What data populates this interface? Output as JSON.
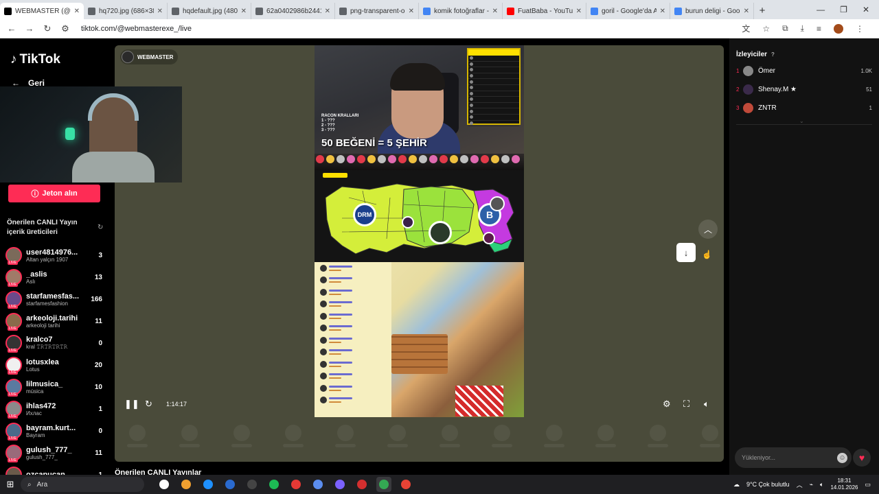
{
  "browser": {
    "tabs": [
      {
        "title": "WEBMASTER (@w",
        "color": "#000000",
        "active": true
      },
      {
        "title": "hq720.jpg (686×386)",
        "color": "#5f6368"
      },
      {
        "title": "hqdefault.jpg (480×3",
        "color": "#5f6368"
      },
      {
        "title": "62a0402986b24419a",
        "color": "#5f6368"
      },
      {
        "title": "png-transparent-ogg",
        "color": "#5f6368"
      },
      {
        "title": "komik fotoğraflar - G",
        "color": "#4285f4"
      },
      {
        "title": "FuatBaba - YouTube",
        "color": "#ff0000"
      },
      {
        "title": "goril - Google'da Ara",
        "color": "#4285f4"
      },
      {
        "title": "burun deligi - Googl",
        "color": "#4285f4"
      }
    ],
    "url": "tiktok.com/@webmasterexe_/live"
  },
  "sidebar": {
    "logo": "TikTok",
    "back_label": "Geri",
    "jeton_label": "Jeton alın",
    "suggested_title": "Önerilen CANLI Yayın içerik üreticileri",
    "creators": [
      {
        "name": "user4814976...",
        "sub": "Altan yalçın 1907",
        "count": "3",
        "color": "#7b6a5a"
      },
      {
        "name": "_aslis",
        "sub": "Aslı",
        "count": "13",
        "color": "#a07a68"
      },
      {
        "name": "starfamesfas...",
        "sub": "starfamesfashion",
        "count": "166",
        "color": "#6a4a8a"
      },
      {
        "name": "arkeoloji.tarihi",
        "sub": "arkeoloji tarihi",
        "count": "11",
        "color": "#8a6a4a"
      },
      {
        "name": "kralco7",
        "sub": "kral 𝚃𝚁𝚃𝚁𝚃𝚁𝚃𝚁",
        "count": "0",
        "color": "#333333"
      },
      {
        "name": "lotusxlea",
        "sub": "Lotus",
        "count": "20",
        "color": "#f0f0f0"
      },
      {
        "name": "lilmusica_",
        "sub": "música",
        "count": "10",
        "color": "#5a7aa0"
      },
      {
        "name": "ihlas472",
        "sub": "Ихлас",
        "count": "1",
        "color": "#8a8a8a"
      },
      {
        "name": "bayram.kurt...",
        "sub": "Bayram",
        "count": "0",
        "color": "#4a6a8a"
      },
      {
        "name": "gulush_777_",
        "sub": "gulush_777_",
        "count": "11",
        "color": "#9a6a7a"
      },
      {
        "name": "ozcanucan",
        "sub": "",
        "count": "1",
        "color": "#6a5a4a"
      }
    ]
  },
  "stage": {
    "host_name": "WEBMASTER",
    "overlay_text": "50 BEĞENİ = 5 ŞEHİR",
    "racon_lines": [
      "RACON KRALLARI",
      "1 - ???",
      "2 - ???",
      "3 - ???"
    ],
    "drm_label": "DRM",
    "b_label": "B",
    "elapsed": "1:14:17",
    "bottom_title": "Önerilen CANLI Yayınlar"
  },
  "viewers_panel": {
    "title": "İzleyiciler",
    "viewers": [
      {
        "rank": "1",
        "name": "Ömer",
        "count": "1.0K",
        "color": "#888888"
      },
      {
        "rank": "2",
        "name": "Shenay.M ★",
        "count": "51",
        "color": "#3a2a4a"
      },
      {
        "rank": "3",
        "name": "ZNTR",
        "count": "1",
        "color": "#c04a3a"
      }
    ],
    "chat_placeholder": "Yükleniyor..."
  },
  "taskbar": {
    "search_label": "Ara",
    "weather": "9°C  Çok bulutlu",
    "time": "18:31",
    "date": "14.01.2026"
  }
}
